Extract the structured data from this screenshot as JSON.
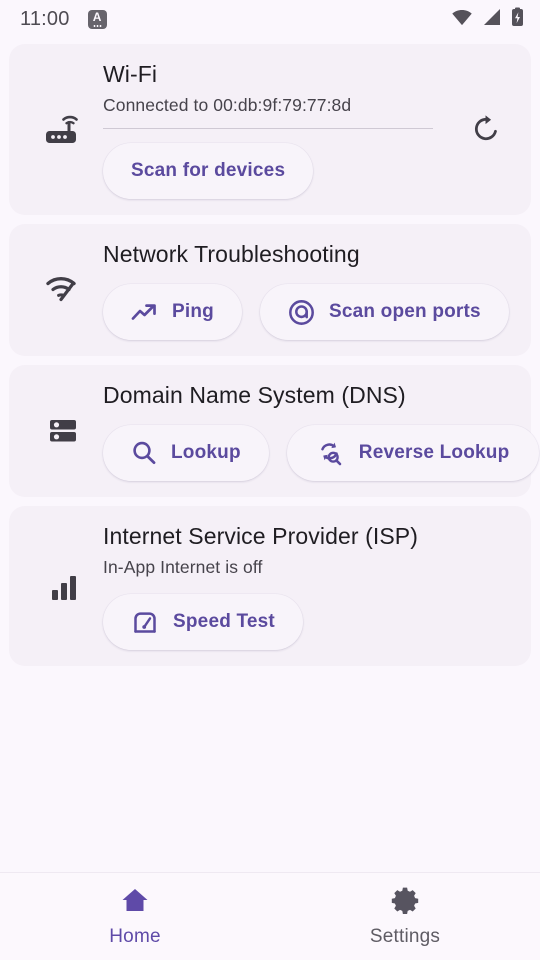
{
  "statusbar": {
    "time": "11:00",
    "badge_letter": "A",
    "icons": [
      "wifi-icon",
      "cell-signal-icon",
      "battery-charging-icon"
    ]
  },
  "theme": {
    "background": "#fbf7fd",
    "card_background": "#f5f0f7",
    "accent": "#5b4a9e",
    "nav_active": "#5f4aa8",
    "nav_inactive": "#5f5c64",
    "title_color": "#1f1d22",
    "icon_color": "#4a474f"
  },
  "cards": [
    {
      "name": "wifi",
      "lead_icon": "router-icon",
      "title": "Wi-Fi",
      "subtitle": "Connected to 00:db:9f:79:77:8d",
      "trailing_icon": "refresh-icon",
      "divider": true,
      "buttons": [
        {
          "label": "Scan for devices",
          "icon": "none"
        }
      ]
    },
    {
      "name": "network-troubleshooting",
      "lead_icon": "network-check-icon",
      "title": "Network Troubleshooting",
      "subtitle": "",
      "trailing_icon": "none",
      "divider": false,
      "buttons": [
        {
          "label": "Ping",
          "icon": "trending-up-icon"
        },
        {
          "label": "Scan open ports",
          "icon": "target-icon"
        }
      ]
    },
    {
      "name": "dns",
      "lead_icon": "dns-server-icon",
      "title": "Domain Name System (DNS)",
      "subtitle": "",
      "trailing_icon": "none",
      "divider": false,
      "buttons": [
        {
          "label": "Lookup",
          "icon": "search-icon"
        },
        {
          "label": "Reverse Lookup",
          "icon": "search-sync-icon"
        }
      ]
    },
    {
      "name": "isp",
      "lead_icon": "signal-bars-icon",
      "title": "Internet Service Provider (ISP)",
      "subtitle": "In-App Internet is off",
      "trailing_icon": "none",
      "divider": false,
      "buttons": [
        {
          "label": "Speed Test",
          "icon": "speedometer-icon"
        }
      ]
    }
  ],
  "bottom_nav": {
    "items": [
      {
        "label": "Home",
        "icon": "home-icon",
        "active": true
      },
      {
        "label": "Settings",
        "icon": "gear-icon",
        "active": false
      }
    ]
  }
}
